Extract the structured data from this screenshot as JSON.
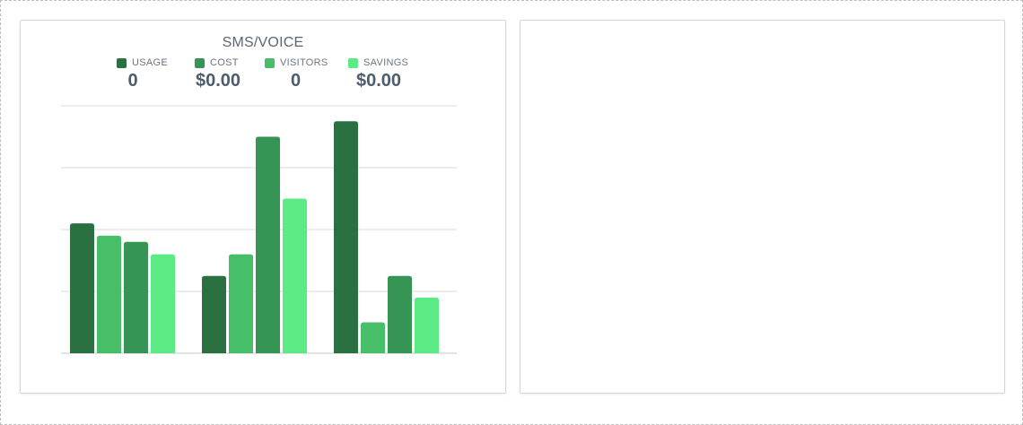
{
  "widgets": [
    {
      "title": "SMS/VOICE",
      "legend": [
        {
          "label": "USAGE",
          "value": "0",
          "color": "#2a7040"
        },
        {
          "label": "COST",
          "value": "$0.00",
          "color": "#369455"
        },
        {
          "label": "VISITORS",
          "value": "0",
          "color": "#47bf69"
        },
        {
          "label": "SAVINGS",
          "value": "$0.00",
          "color": "#5cea85"
        }
      ]
    }
  ],
  "chart_data": {
    "type": "bar",
    "grid": true,
    "ylim": [
      0,
      4
    ],
    "series": [
      {
        "color": "#2a7040",
        "values": [
          2.1,
          1.25,
          3.75
        ]
      },
      {
        "color": "#47bf69",
        "values": [
          1.9,
          1.6,
          0.5
        ]
      },
      {
        "color": "#369455",
        "values": [
          1.8,
          3.5,
          1.25
        ]
      },
      {
        "color": "#5cea85",
        "values": [
          1.6,
          2.5,
          0.9
        ]
      }
    ]
  }
}
